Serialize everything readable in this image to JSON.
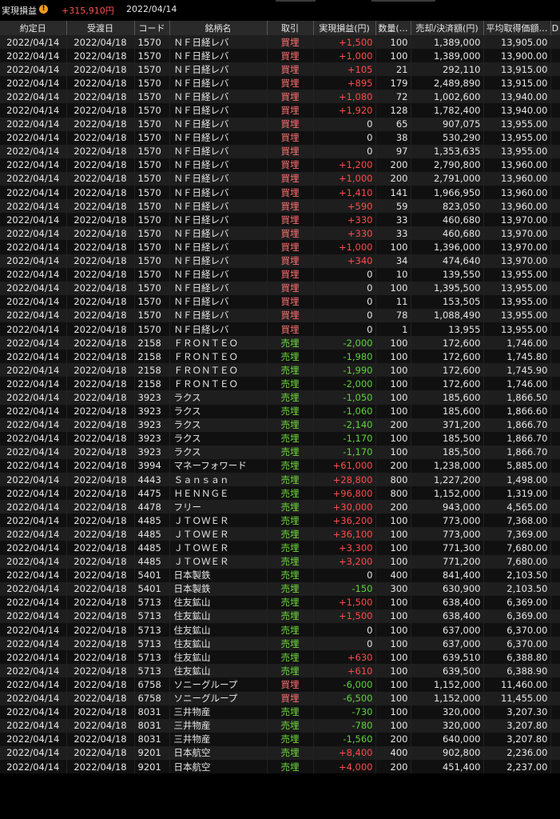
{
  "header": {
    "title": "実現損益",
    "total_pnl": "+315,910円",
    "date": "2022/04/14"
  },
  "columns": [
    "約定日",
    "受渡日",
    "コード",
    "銘柄名",
    "取引",
    "実現損益(円)",
    "数量(…",
    "売却/決済額(円)",
    "平均取得価額…",
    "D"
  ],
  "rows": [
    [
      "2022/04/14",
      "2022/04/18",
      "1570",
      "ＮＦ日経レバ",
      "買埋",
      "+1,500",
      "100",
      "1,389,000",
      "13,905.00"
    ],
    [
      "2022/04/14",
      "2022/04/18",
      "1570",
      "ＮＦ日経レバ",
      "買埋",
      "+1,000",
      "100",
      "1,389,000",
      "13,900.00"
    ],
    [
      "2022/04/14",
      "2022/04/18",
      "1570",
      "ＮＦ日経レバ",
      "買埋",
      "+105",
      "21",
      "292,110",
      "13,915.00"
    ],
    [
      "2022/04/14",
      "2022/04/18",
      "1570",
      "ＮＦ日経レバ",
      "買埋",
      "+895",
      "179",
      "2,489,890",
      "13,915.00"
    ],
    [
      "2022/04/14",
      "2022/04/18",
      "1570",
      "ＮＦ日経レバ",
      "買埋",
      "+1,080",
      "72",
      "1,002,600",
      "13,940.00"
    ],
    [
      "2022/04/14",
      "2022/04/18",
      "1570",
      "ＮＦ日経レバ",
      "買埋",
      "+1,920",
      "128",
      "1,782,400",
      "13,940.00"
    ],
    [
      "2022/04/14",
      "2022/04/18",
      "1570",
      "ＮＦ日経レバ",
      "買埋",
      "0",
      "65",
      "907,075",
      "13,955.00"
    ],
    [
      "2022/04/14",
      "2022/04/18",
      "1570",
      "ＮＦ日経レバ",
      "買埋",
      "0",
      "38",
      "530,290",
      "13,955.00"
    ],
    [
      "2022/04/14",
      "2022/04/18",
      "1570",
      "ＮＦ日経レバ",
      "買埋",
      "0",
      "97",
      "1,353,635",
      "13,955.00"
    ],
    [
      "2022/04/14",
      "2022/04/18",
      "1570",
      "ＮＦ日経レバ",
      "買埋",
      "+1,200",
      "200",
      "2,790,800",
      "13,960.00"
    ],
    [
      "2022/04/14",
      "2022/04/18",
      "1570",
      "ＮＦ日経レバ",
      "買埋",
      "+1,000",
      "200",
      "2,791,000",
      "13,960.00"
    ],
    [
      "2022/04/14",
      "2022/04/18",
      "1570",
      "ＮＦ日経レバ",
      "買埋",
      "+1,410",
      "141",
      "1,966,950",
      "13,960.00"
    ],
    [
      "2022/04/14",
      "2022/04/18",
      "1570",
      "ＮＦ日経レバ",
      "買埋",
      "+590",
      "59",
      "823,050",
      "13,960.00"
    ],
    [
      "2022/04/14",
      "2022/04/18",
      "1570",
      "ＮＦ日経レバ",
      "買埋",
      "+330",
      "33",
      "460,680",
      "13,970.00"
    ],
    [
      "2022/04/14",
      "2022/04/18",
      "1570",
      "ＮＦ日経レバ",
      "買埋",
      "+330",
      "33",
      "460,680",
      "13,970.00"
    ],
    [
      "2022/04/14",
      "2022/04/18",
      "1570",
      "ＮＦ日経レバ",
      "買埋",
      "+1,000",
      "100",
      "1,396,000",
      "13,970.00"
    ],
    [
      "2022/04/14",
      "2022/04/18",
      "1570",
      "ＮＦ日経レバ",
      "買埋",
      "+340",
      "34",
      "474,640",
      "13,970.00"
    ],
    [
      "2022/04/14",
      "2022/04/18",
      "1570",
      "ＮＦ日経レバ",
      "買埋",
      "0",
      "10",
      "139,550",
      "13,955.00"
    ],
    [
      "2022/04/14",
      "2022/04/18",
      "1570",
      "ＮＦ日経レバ",
      "買埋",
      "0",
      "100",
      "1,395,500",
      "13,955.00"
    ],
    [
      "2022/04/14",
      "2022/04/18",
      "1570",
      "ＮＦ日経レバ",
      "買埋",
      "0",
      "11",
      "153,505",
      "13,955.00"
    ],
    [
      "2022/04/14",
      "2022/04/18",
      "1570",
      "ＮＦ日経レバ",
      "買埋",
      "0",
      "78",
      "1,088,490",
      "13,955.00"
    ],
    [
      "2022/04/14",
      "2022/04/18",
      "1570",
      "ＮＦ日経レバ",
      "買埋",
      "0",
      "1",
      "13,955",
      "13,955.00"
    ],
    [
      "2022/04/14",
      "2022/04/18",
      "2158",
      "ＦＲＯＮＴＥＯ",
      "売埋",
      "-2,000",
      "100",
      "172,600",
      "1,746.00"
    ],
    [
      "2022/04/14",
      "2022/04/18",
      "2158",
      "ＦＲＯＮＴＥＯ",
      "売埋",
      "-1,980",
      "100",
      "172,600",
      "1,745.80"
    ],
    [
      "2022/04/14",
      "2022/04/18",
      "2158",
      "ＦＲＯＮＴＥＯ",
      "売埋",
      "-1,990",
      "100",
      "172,600",
      "1,745.90"
    ],
    [
      "2022/04/14",
      "2022/04/18",
      "2158",
      "ＦＲＯＮＴＥＯ",
      "売埋",
      "-2,000",
      "100",
      "172,600",
      "1,746.00"
    ],
    [
      "2022/04/14",
      "2022/04/18",
      "3923",
      "ラクス",
      "売埋",
      "-1,050",
      "100",
      "185,600",
      "1,866.50"
    ],
    [
      "2022/04/14",
      "2022/04/18",
      "3923",
      "ラクス",
      "売埋",
      "-1,060",
      "100",
      "185,600",
      "1,866.60"
    ],
    [
      "2022/04/14",
      "2022/04/18",
      "3923",
      "ラクス",
      "売埋",
      "-2,140",
      "200",
      "371,200",
      "1,866.70"
    ],
    [
      "2022/04/14",
      "2022/04/18",
      "3923",
      "ラクス",
      "売埋",
      "-1,170",
      "100",
      "185,500",
      "1,866.70"
    ],
    [
      "2022/04/14",
      "2022/04/18",
      "3923",
      "ラクス",
      "売埋",
      "-1,170",
      "100",
      "185,500",
      "1,866.70"
    ],
    [
      "2022/04/14",
      "2022/04/18",
      "3994",
      "マネーフォワード",
      "売埋",
      "+61,000",
      "200",
      "1,238,000",
      "5,885.00"
    ],
    [
      "2022/04/14",
      "2022/04/18",
      "4443",
      "Ｓａｎｓａｎ",
      "売埋",
      "+28,800",
      "800",
      "1,227,200",
      "1,498.00"
    ],
    [
      "2022/04/14",
      "2022/04/18",
      "4475",
      "ＨＥＮＮＧＥ",
      "売埋",
      "+96,800",
      "800",
      "1,152,000",
      "1,319.00"
    ],
    [
      "2022/04/14",
      "2022/04/18",
      "4478",
      "フリー",
      "売埋",
      "+30,000",
      "200",
      "943,000",
      "4,565.00"
    ],
    [
      "2022/04/14",
      "2022/04/18",
      "4485",
      "ＪＴＯＷＥＲ",
      "売埋",
      "+36,200",
      "100",
      "773,000",
      "7,368.00"
    ],
    [
      "2022/04/14",
      "2022/04/18",
      "4485",
      "ＪＴＯＷＥＲ",
      "売埋",
      "+36,100",
      "100",
      "773,000",
      "7,369.00"
    ],
    [
      "2022/04/14",
      "2022/04/18",
      "4485",
      "ＪＴＯＷＥＲ",
      "売埋",
      "+3,300",
      "100",
      "771,300",
      "7,680.00"
    ],
    [
      "2022/04/14",
      "2022/04/18",
      "4485",
      "ＪＴＯＷＥＲ",
      "売埋",
      "+3,200",
      "100",
      "771,200",
      "7,680.00"
    ],
    [
      "2022/04/14",
      "2022/04/18",
      "5401",
      "日本製鉄",
      "売埋",
      "0",
      "400",
      "841,400",
      "2,103.50"
    ],
    [
      "2022/04/14",
      "2022/04/18",
      "5401",
      "日本製鉄",
      "売埋",
      "-150",
      "300",
      "630,900",
      "2,103.50"
    ],
    [
      "2022/04/14",
      "2022/04/18",
      "5713",
      "住友鉱山",
      "売埋",
      "+1,500",
      "100",
      "638,400",
      "6,369.00"
    ],
    [
      "2022/04/14",
      "2022/04/18",
      "5713",
      "住友鉱山",
      "売埋",
      "+1,500",
      "100",
      "638,400",
      "6,369.00"
    ],
    [
      "2022/04/14",
      "2022/04/18",
      "5713",
      "住友鉱山",
      "売埋",
      "0",
      "100",
      "637,000",
      "6,370.00"
    ],
    [
      "2022/04/14",
      "2022/04/18",
      "5713",
      "住友鉱山",
      "売埋",
      "0",
      "100",
      "637,000",
      "6,370.00"
    ],
    [
      "2022/04/14",
      "2022/04/18",
      "5713",
      "住友鉱山",
      "売埋",
      "+630",
      "100",
      "639,510",
      "6,388.80"
    ],
    [
      "2022/04/14",
      "2022/04/18",
      "5713",
      "住友鉱山",
      "売埋",
      "+610",
      "100",
      "639,500",
      "6,388.90"
    ],
    [
      "2022/04/14",
      "2022/04/18",
      "6758",
      "ソニーグループ",
      "買埋",
      "-6,000",
      "100",
      "1,152,000",
      "11,460.00"
    ],
    [
      "2022/04/14",
      "2022/04/18",
      "6758",
      "ソニーグループ",
      "買埋",
      "-6,500",
      "100",
      "1,152,000",
      "11,455.00"
    ],
    [
      "2022/04/14",
      "2022/04/18",
      "8031",
      "三井物産",
      "売埋",
      "-730",
      "100",
      "320,000",
      "3,207.30"
    ],
    [
      "2022/04/14",
      "2022/04/18",
      "8031",
      "三井物産",
      "売埋",
      "-780",
      "100",
      "320,000",
      "3,207.80"
    ],
    [
      "2022/04/14",
      "2022/04/18",
      "8031",
      "三井物産",
      "売埋",
      "-1,560",
      "200",
      "640,000",
      "3,207.80"
    ],
    [
      "2022/04/14",
      "2022/04/18",
      "9201",
      "日本航空",
      "売埋",
      "+8,400",
      "400",
      "902,800",
      "2,236.00"
    ],
    [
      "2022/04/14",
      "2022/04/18",
      "9201",
      "日本航空",
      "売埋",
      "+4,000",
      "200",
      "451,400",
      "2,237.00"
    ]
  ],
  "colors": {
    "buy": "#ff7070",
    "sell": "#6ddc3c",
    "positive": "#ff4a4a",
    "negative": "#5ed33a",
    "warning": "#f59a23"
  }
}
